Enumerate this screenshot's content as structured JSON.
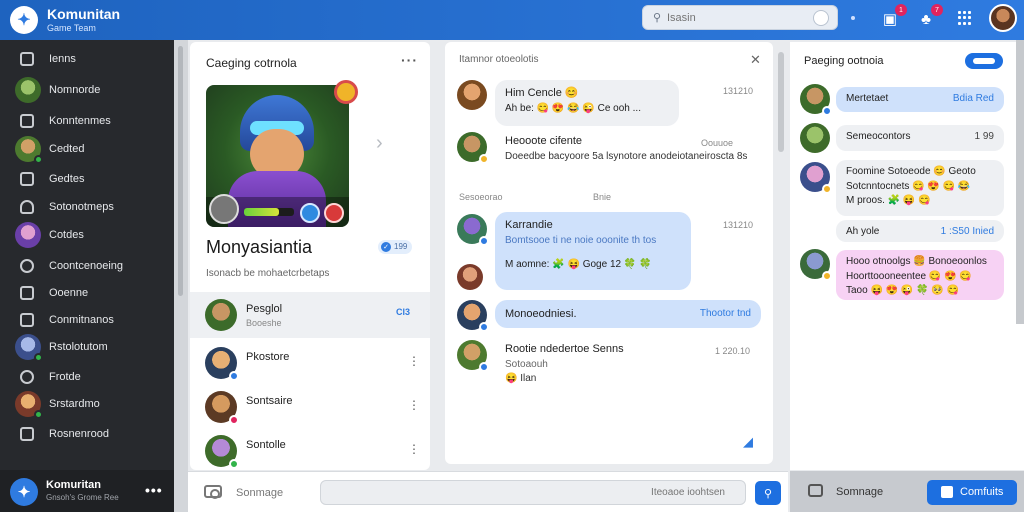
{
  "app": {
    "title": "Komunitan",
    "subtitle": "Game Team",
    "logo_icon": "puzzle-icon"
  },
  "search": {
    "placeholder": "Isasin"
  },
  "topbar": {
    "badge1": "1",
    "badge2": "7",
    "icons": [
      "notification-icon",
      "friends-icon",
      "apps-grid-icon",
      "profile-avatar"
    ]
  },
  "nav": {
    "items": [
      {
        "label": "Ienns",
        "kind": "icon"
      },
      {
        "label": "Nomnorde",
        "kind": "avatar"
      },
      {
        "label": "Konntenmes",
        "kind": "icon"
      },
      {
        "label": "Cedted",
        "kind": "avatar"
      },
      {
        "label": "Gedtes",
        "kind": "icon"
      },
      {
        "label": "Sotonotmeps",
        "kind": "icon"
      },
      {
        "label": "Cotdes",
        "kind": "avatar"
      },
      {
        "label": "Coontcenoeing",
        "kind": "icon"
      },
      {
        "label": "Ooenne",
        "kind": "icon"
      },
      {
        "label": "Conmitnanos",
        "kind": "icon"
      },
      {
        "label": "Rstolotutom",
        "kind": "avatar"
      },
      {
        "label": "Frotde",
        "kind": "icon"
      },
      {
        "label": "Srstardmo",
        "kind": "avatar"
      },
      {
        "label": "Rosnenrood",
        "kind": "icon"
      }
    ],
    "footer": {
      "title": "Komuritan",
      "subtitle": "Gnsoh's Grome Ree"
    }
  },
  "left_panel": {
    "title": "Caeging cotrnola",
    "game_title": "Monyasiantia",
    "game_desc": "Isonacb be mohaetcrbetaps",
    "verified_count": "199",
    "health_fraction": 0.7,
    "channels": [
      {
        "name": "Pesglol",
        "sub": "Booeshe",
        "tag": "Cl3",
        "active": true
      },
      {
        "name": "Pkostore",
        "sub": "",
        "tag": "",
        "active": false
      },
      {
        "name": "Sontsaire",
        "sub": "",
        "tag": "",
        "active": false
      },
      {
        "name": "Sontolle",
        "sub": "",
        "tag": "",
        "active": false
      }
    ]
  },
  "chat": {
    "header": "Itamnor otoeolotis",
    "messages": [
      {
        "name": "Him Cencle 😊",
        "text": "Ah be: 😋 😍 😂 😜 Ce ooh ...",
        "time": "131210",
        "style": "grey"
      },
      {
        "name": "Heooote cifente",
        "text": "Doeedbe bacyoore 5a lsynotore anodeiotaneiroscta 8s",
        "time": "Oouuoe",
        "style": "plain"
      },
      {
        "section_left": "Sesoeorao",
        "section_right": "Bnie"
      },
      {
        "name": "Karrandie",
        "text1": "Bomtsooe ti ne noie ooonite th tos",
        "text2": "M aomne: 🧩 😝 Goge 12 🍀 🍀",
        "time": "131210",
        "style": "blue"
      },
      {
        "name": "Monoeodniesi.",
        "text": "Thootor tnd",
        "style": "blue-wide"
      },
      {
        "name": "Rootie ndedertoe Senns",
        "text1": "Sotoaouh",
        "text2": "😝 Ilan",
        "time": "1 220.10",
        "style": "plain"
      }
    ]
  },
  "right_panel": {
    "title": "Paeging ootnoia",
    "items": [
      {
        "text": "Mertetaet",
        "right": "Bdia Red",
        "style": "blue"
      },
      {
        "text": "Semeocontors",
        "right": "1 99",
        "style": "grey"
      },
      {
        "text": "Foomine Sotoeode 😊 Geoto",
        "text2": "Sotcnntocnets 😋 😍 😋 😂",
        "text3": "M proos. 🧩 😝 😋",
        "style": "grey"
      },
      {
        "text": "Ah yole",
        "right": "1 :S50 Inied",
        "style": "blue"
      },
      {
        "text": "Hooo otnoolgs 🍔 Bonoeoonlos",
        "text2": "Hoorttoooneentee 😋 😍 😋",
        "text3": "Taoo 😝 😍 😜 🍀 🥺 😋",
        "style": "pink"
      }
    ]
  },
  "composer": {
    "label": "Sonmage",
    "placeholder": "Iteoaoe ioohtsen"
  },
  "right_footer": {
    "label": "Somnage",
    "button": "Comfuits"
  },
  "colors": {
    "accent": "#2f7be0",
    "topbar": "#1e63bf",
    "nav_bg": "#27292d"
  }
}
